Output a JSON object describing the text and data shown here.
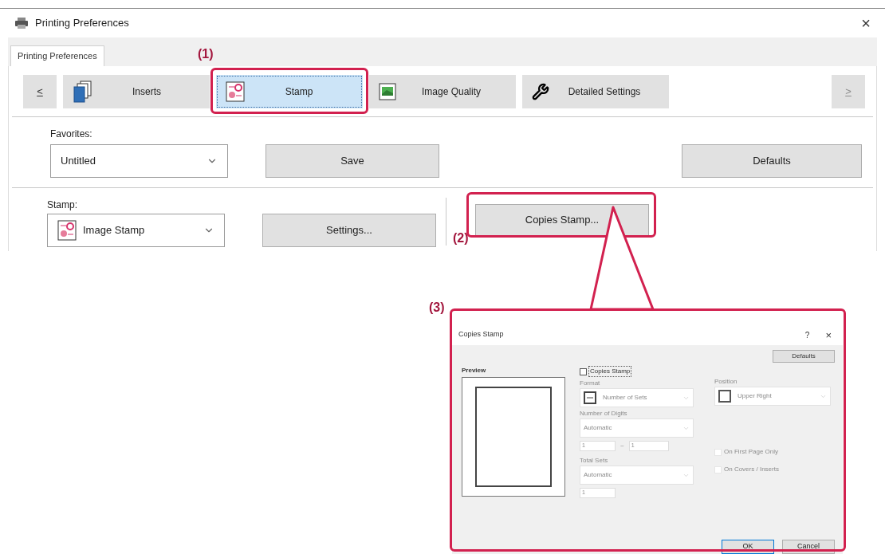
{
  "window": {
    "title": "Printing Preferences",
    "close": "×"
  },
  "tab": {
    "label": "Printing Preferences",
    "selected": true
  },
  "nav": {
    "prev": {
      "label": "<",
      "disabled": false
    },
    "next": {
      "label": ">",
      "disabled": true
    },
    "items": [
      {
        "label": "Inserts",
        "kind": "inserts",
        "selected": false
      },
      {
        "label": "Stamp",
        "kind": "stamp",
        "selected": true
      },
      {
        "label": "Image Quality",
        "kind": "quality",
        "selected": false
      },
      {
        "label": "Detailed Settings",
        "kind": "wrench",
        "selected": false
      }
    ]
  },
  "favorites": {
    "label": "Favorites:",
    "value": "Untitled",
    "save": "Save",
    "defaults": "Defaults"
  },
  "stamp": {
    "label": "Stamp:",
    "value": "Image Stamp",
    "settings": "Settings...",
    "copies_stamp": "Copies Stamp..."
  },
  "annotations": [
    "(1)",
    "(2)",
    "(3)"
  ],
  "dialog": {
    "title": "Copies Stamp",
    "help": "?",
    "close": "×",
    "defaults": "Defaults",
    "preview_label": "Preview",
    "enable": {
      "label": "Copies Stamp",
      "checked": false
    },
    "format": {
      "label": "Format",
      "value": "Number of Sets",
      "disabled": true
    },
    "digits": {
      "label": "Number of Digits",
      "value": "Automatic",
      "disabled": true
    },
    "range": {
      "from": "1",
      "separator": "~",
      "to": "1",
      "disabled": true
    },
    "total": {
      "label": "Total Sets",
      "value": "Automatic",
      "disabled": true
    },
    "total_count": {
      "value": "1",
      "disabled": true
    },
    "position": {
      "label": "Position",
      "value": "Upper Right",
      "disabled": true
    },
    "options": [
      {
        "label": "On First Page Only",
        "checked": false,
        "disabled": true
      },
      {
        "label": "On Covers / Inserts",
        "checked": false,
        "disabled": true
      }
    ],
    "buttons": [
      {
        "label": "OK",
        "default": true
      },
      {
        "label": "Cancel",
        "default": false
      }
    ]
  }
}
